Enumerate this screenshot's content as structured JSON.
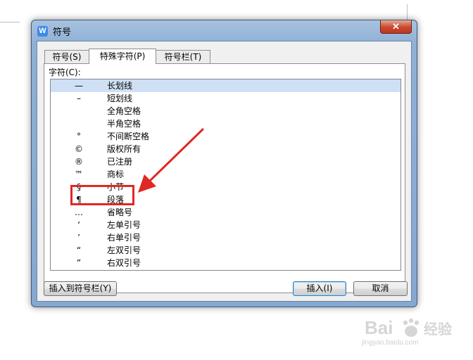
{
  "dialog": {
    "title": "符号",
    "app_icon_glyph": "W",
    "close_glyph": "✕"
  },
  "tabs": [
    {
      "label": "符号(S)",
      "active": false
    },
    {
      "label": "特殊字符(P)",
      "active": true
    },
    {
      "label": "符号栏(T)",
      "active": false
    }
  ],
  "characters": {
    "label": "字符(C):",
    "rows": [
      {
        "symbol": "—",
        "name": "长划线",
        "selected": true
      },
      {
        "symbol": "–",
        "name": "短划线",
        "selected": false
      },
      {
        "symbol": "",
        "name": "全角空格",
        "selected": false
      },
      {
        "symbol": "",
        "name": "半角空格",
        "selected": false
      },
      {
        "symbol": "°",
        "name": "不间断空格",
        "selected": false
      },
      {
        "symbol": "©",
        "name": "版权所有",
        "selected": false
      },
      {
        "symbol": "®",
        "name": "已注册",
        "selected": false
      },
      {
        "symbol": "™",
        "name": "商标",
        "selected": false
      },
      {
        "symbol": "§",
        "name": "小节",
        "selected": false
      },
      {
        "symbol": "¶",
        "name": "段落",
        "selected": false
      },
      {
        "symbol": "…",
        "name": "省略号",
        "selected": false
      },
      {
        "symbol": "‘",
        "name": "左单引号",
        "selected": false
      },
      {
        "symbol": "’",
        "name": "右单引号",
        "selected": false
      },
      {
        "symbol": "“",
        "name": "左双引号",
        "selected": false
      },
      {
        "symbol": "”",
        "name": "右双引号",
        "selected": false
      }
    ]
  },
  "buttons": {
    "insert_to_bar": "插入到符号栏(Y)",
    "insert": "插入(I)",
    "cancel": "取消"
  },
  "annotation": {
    "highlighted_item": "段落",
    "color": "#e02826"
  },
  "watermark": {
    "brand": "Bai",
    "brand_suffix": "经验",
    "url": "jingyan.baidu.com"
  }
}
